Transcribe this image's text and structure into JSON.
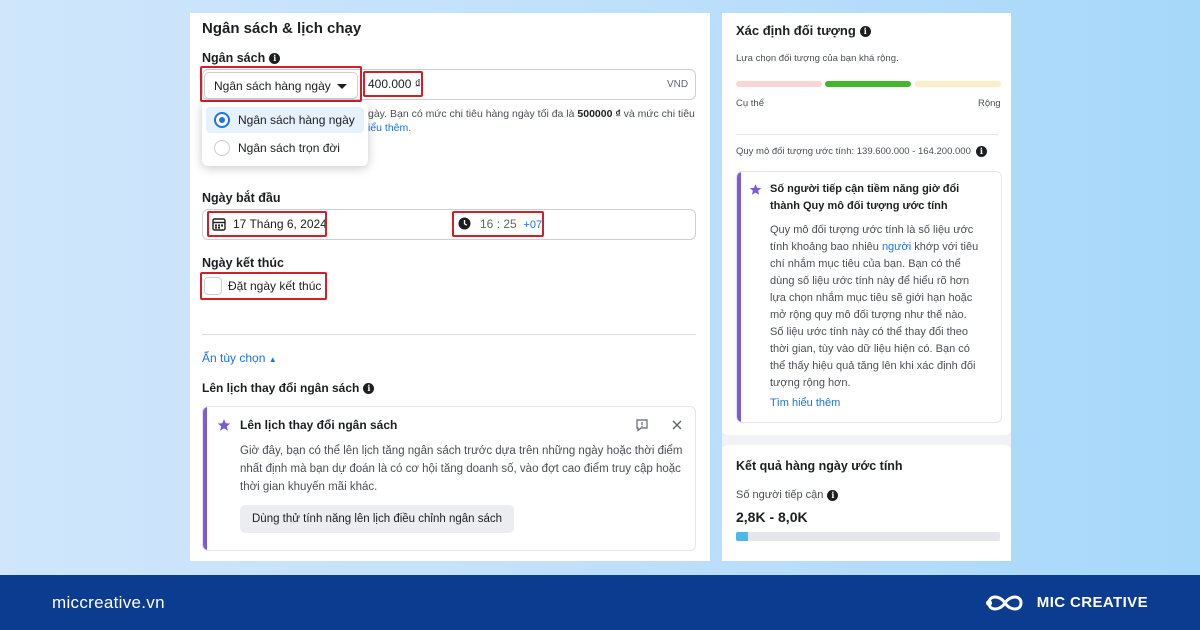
{
  "footer": {
    "site": "miccreative.vn",
    "brand": "MIC CREATIVE"
  },
  "left": {
    "section_title": "Ngân sách & lịch chạy",
    "budget_label": "Ngân sách",
    "budget_select": "Ngân sách hàng ngày",
    "budget_amount": "400.000 ₫",
    "currency": "VND",
    "budget_hint_1": "gày. Bạn có mức chi tiêu hàng ngày tối đa là",
    "budget_hint_bold": "500000 ₫",
    "budget_hint_2": "và mức chi tiêu",
    "budget_hint_link": "iểu thêm.",
    "options": [
      {
        "label": "Ngân sách hàng ngày",
        "selected": true
      },
      {
        "label": "Ngân sách trọn đời",
        "selected": false
      }
    ],
    "start_label": "Ngày bắt đầu",
    "start_date": "17 Tháng 6, 2024",
    "start_hour": "16",
    "start_minute": "25",
    "timezone": "+07",
    "end_label": "Ngày kết thúc",
    "end_checkbox": "Đặt ngày kết thúc",
    "hide_options": "Ẩn tùy chọn",
    "schedule_label": "Lên lịch thay đổi ngân sách",
    "schedule_card": {
      "title": "Lên lịch thay đổi ngân sách",
      "body": "Giờ đây, bạn có thể lên lịch tăng ngân sách trước dựa trên những ngày hoặc thời điểm nhất định mà bạn dự đoán là có cơ hội tăng doanh số, vào đợt cao điểm truy cập hoặc thời gian khuyến mãi khác.",
      "button": "Dùng thử tính năng lên lịch điều chỉnh ngân sách"
    }
  },
  "right": {
    "audience_title": "Xác định đối tượng",
    "audience_sub": "Lựa chọn đối tượng của bạn khá rộng.",
    "specific": "Cụ thể",
    "broad": "Rộng",
    "audience_size": "Quy mô đối tượng ước tính: 139.600.000 - 164.200.000",
    "tip_title": "Số người tiếp cận tiềm năng giờ đổi thành Quy mô đối tượng ước tính",
    "tip_lines": [
      "Quy mô đối tượng ước tính là số liệu ước",
      "tính khoảng bao nhiêu",
      "khớp với tiêu",
      "chí nhắm mục tiêu của bạn. Bạn có thể",
      "dùng số liệu ước tính này để hiểu rõ hơn",
      "lựa chọn nhắm mục tiêu sẽ giới hạn hoặc",
      "mở rộng quy mô đối tượng như thế nào.",
      "Số liệu ước tính này có thể thay đổi theo",
      "thời gian, tùy vào dữ liệu hiện có. Bạn có",
      "thể thấy hiệu quả tăng lên khi xác định đối",
      "tượng rộng hơn."
    ],
    "tip_link_word": "người",
    "learn_more": "Tìm hiểu thêm",
    "results_title": "Kết quả hàng ngày ước tính",
    "reach_label": "Số người tiếp cận",
    "reach_value": "2,8K - 8,0K",
    "reach_fill": 0.045
  },
  "colors": {
    "accent": "#1a73e8",
    "highlight": "#d0202a",
    "purple": "#7c5bd6",
    "footer": "#0c3c8f",
    "bar_green": "#42b72a",
    "bar_left": "#f7d6d3",
    "bar_right": "#fdeec8",
    "reach_bar": "#4cb8e8"
  }
}
